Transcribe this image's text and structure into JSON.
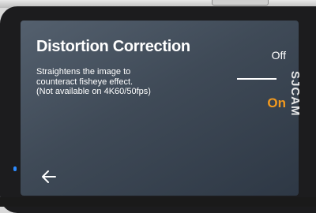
{
  "screen": {
    "title": "Distortion Correction",
    "description_lines": [
      "Straightens the image to",
      "counteract fisheye effect.",
      "(Not available on 4K60/50fps)"
    ],
    "options": [
      {
        "label": "Off",
        "selected": false
      },
      {
        "label": "On",
        "selected": true
      }
    ],
    "back_icon": "arrow-left-icon"
  },
  "device": {
    "brand": "SJCAM"
  },
  "colors": {
    "selected": "#f39a1e",
    "text": "#ffffff"
  }
}
